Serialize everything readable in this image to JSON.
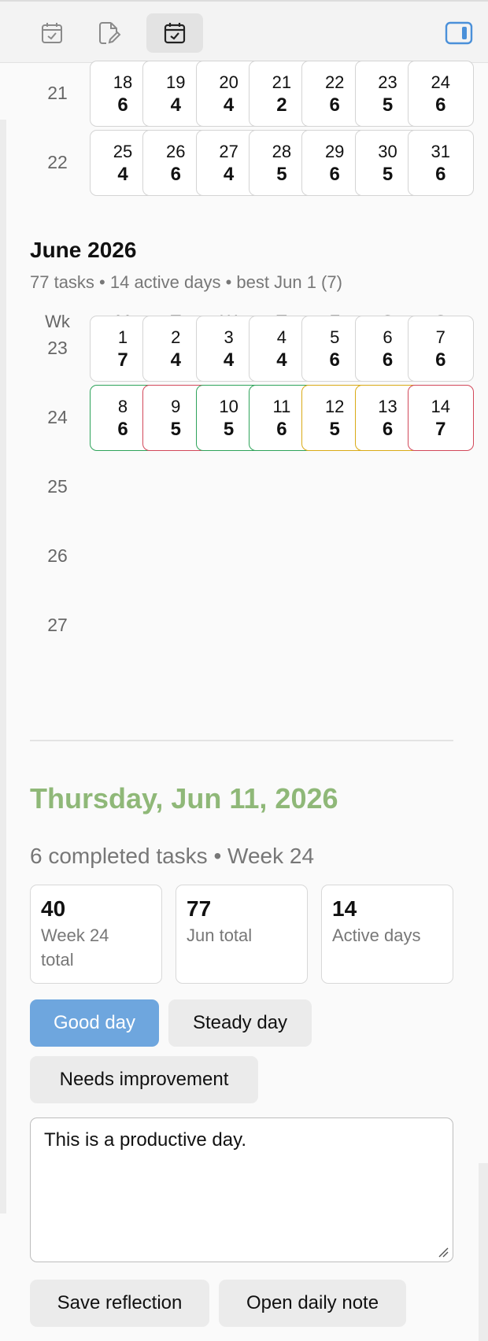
{
  "toolbar": {
    "buttons": [
      {
        "name": "calendar-check-icon",
        "active": false
      },
      {
        "name": "edit-note-icon",
        "active": false
      },
      {
        "name": "calendar-active-icon",
        "active": true
      }
    ],
    "sidebar_toggle": "sidebar-toggle-icon"
  },
  "may_tail": {
    "weeks": [
      {
        "week": "21",
        "days": [
          {
            "d": "18",
            "c": "6"
          },
          {
            "d": "19",
            "c": "4"
          },
          {
            "d": "20",
            "c": "4"
          },
          {
            "d": "21",
            "c": "2"
          },
          {
            "d": "22",
            "c": "6"
          },
          {
            "d": "23",
            "c": "5"
          },
          {
            "d": "24",
            "c": "6"
          }
        ]
      },
      {
        "week": "22",
        "days": [
          {
            "d": "25",
            "c": "4"
          },
          {
            "d": "26",
            "c": "6"
          },
          {
            "d": "27",
            "c": "4"
          },
          {
            "d": "28",
            "c": "5"
          },
          {
            "d": "29",
            "c": "6"
          },
          {
            "d": "30",
            "c": "5"
          },
          {
            "d": "31",
            "c": "6"
          }
        ]
      }
    ]
  },
  "month": {
    "title": "June 2026",
    "summary": "77 tasks • 14 active days • best Jun 1 (7)",
    "headers": [
      "Wk",
      "M",
      "T",
      "W",
      "T",
      "F",
      "S",
      "S"
    ],
    "weeks": [
      {
        "week": "23",
        "days": [
          {
            "d": "1",
            "c": "7"
          },
          {
            "d": "2",
            "c": "4"
          },
          {
            "d": "3",
            "c": "4"
          },
          {
            "d": "4",
            "c": "4"
          },
          {
            "d": "5",
            "c": "6"
          },
          {
            "d": "6",
            "c": "6"
          },
          {
            "d": "7",
            "c": "6"
          }
        ]
      },
      {
        "week": "24",
        "days": [
          {
            "d": "8",
            "c": "6",
            "mood": "green"
          },
          {
            "d": "9",
            "c": "5",
            "mood": "red"
          },
          {
            "d": "10",
            "c": "5",
            "mood": "green"
          },
          {
            "d": "11",
            "c": "6",
            "mood": "green"
          },
          {
            "d": "12",
            "c": "5",
            "mood": "amber"
          },
          {
            "d": "13",
            "c": "6",
            "mood": "amber"
          },
          {
            "d": "14",
            "c": "7",
            "mood": "red"
          }
        ]
      },
      {
        "week": "25",
        "days": []
      },
      {
        "week": "26",
        "days": []
      },
      {
        "week": "27",
        "days": []
      }
    ]
  },
  "mood_colors": {
    "green": "#2ea35a",
    "red": "#d2485a",
    "amber": "#d9aa16"
  },
  "selected": {
    "title": "Thursday, Jun 11, 2026",
    "subtitle": "6 completed tasks • Week 24",
    "stats": [
      {
        "value": "40",
        "label": "Week 24 total"
      },
      {
        "value": "77",
        "label": "Jun total"
      },
      {
        "value": "14",
        "label": "Active days"
      }
    ],
    "moods": [
      {
        "label": "Good day",
        "active": true
      },
      {
        "label": "Steady day",
        "active": false
      },
      {
        "label": "Needs improvement",
        "active": false
      }
    ],
    "reflection": "This is a productive day.",
    "actions": {
      "save": "Save reflection",
      "open": "Open daily note"
    }
  },
  "colors": {
    "accent": "#6ea6de",
    "date_title": "#8fb878"
  }
}
